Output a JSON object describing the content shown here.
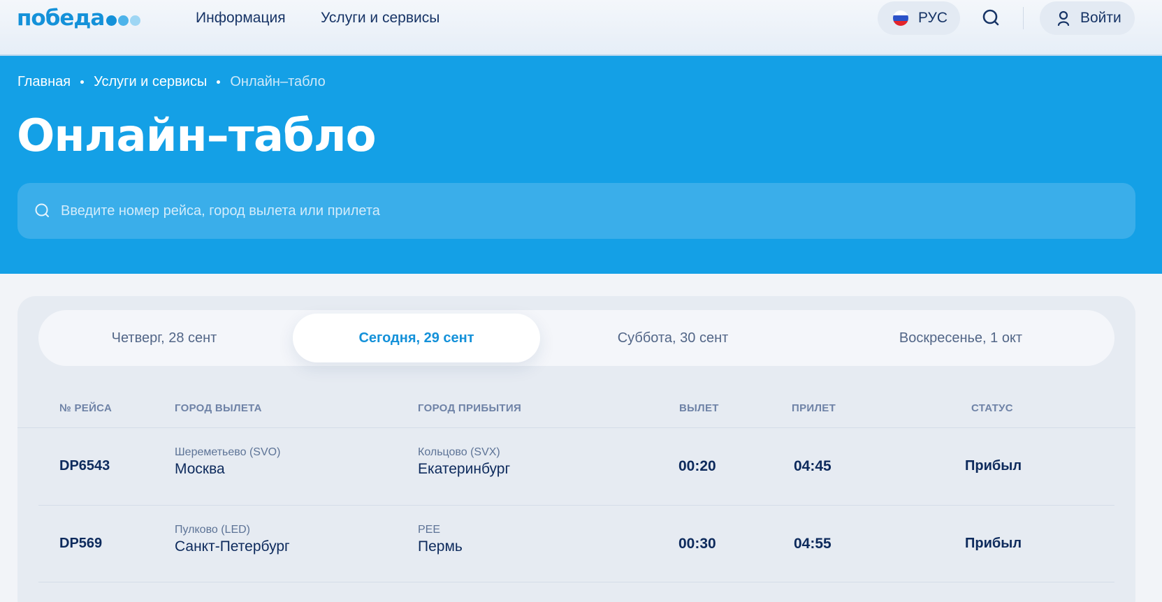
{
  "header": {
    "logo_text": "победа",
    "logo_dot_colors": [
      "#1491d9",
      "#4db3ea",
      "#9ed6f4"
    ],
    "nav": [
      {
        "label": "Информация"
      },
      {
        "label": "Услуги и сервисы"
      }
    ],
    "lang_label": "РУС",
    "login_label": "Войти"
  },
  "hero": {
    "breadcrumbs": [
      "Главная",
      "Услуги и сервисы",
      "Онлайн–табло"
    ],
    "title": "Онлайн–табло",
    "search_placeholder": "Введите номер рейса, город вылета или прилета"
  },
  "board": {
    "date_tabs": [
      {
        "label": "Четверг, 28 сент",
        "active": false
      },
      {
        "label": "Сегодня, 29 сент",
        "active": true
      },
      {
        "label": "Суббота, 30 сент",
        "active": false
      },
      {
        "label": "Воскресенье, 1 окт",
        "active": false
      }
    ],
    "columns": [
      "№ РЕЙСА",
      "ГОРОД ВЫЛЕТА",
      "ГОРОД ПРИБЫТИЯ",
      "ВЫЛЕТ",
      "ПРИЛЕТ",
      "СТАТУС"
    ],
    "flights": [
      {
        "number": "DP6543",
        "dep_airport": "Шереметьево (SVO)",
        "dep_city": "Москва",
        "arr_airport": "Кольцово (SVX)",
        "arr_city": "Екатеринбург",
        "dep_time": "00:20",
        "arr_time": "04:45",
        "status": "Прибыл"
      },
      {
        "number": "DP569",
        "dep_airport": "Пулково (LED)",
        "dep_city": "Санкт-Петербург",
        "arr_airport": "PEE",
        "arr_city": "Пермь",
        "dep_time": "00:30",
        "arr_time": "04:55",
        "status": "Прибыл"
      }
    ]
  },
  "colors": {
    "brand_blue": "#1491d9",
    "hero_bg": "#14a0e6",
    "text_dark": "#0d2a5c"
  }
}
